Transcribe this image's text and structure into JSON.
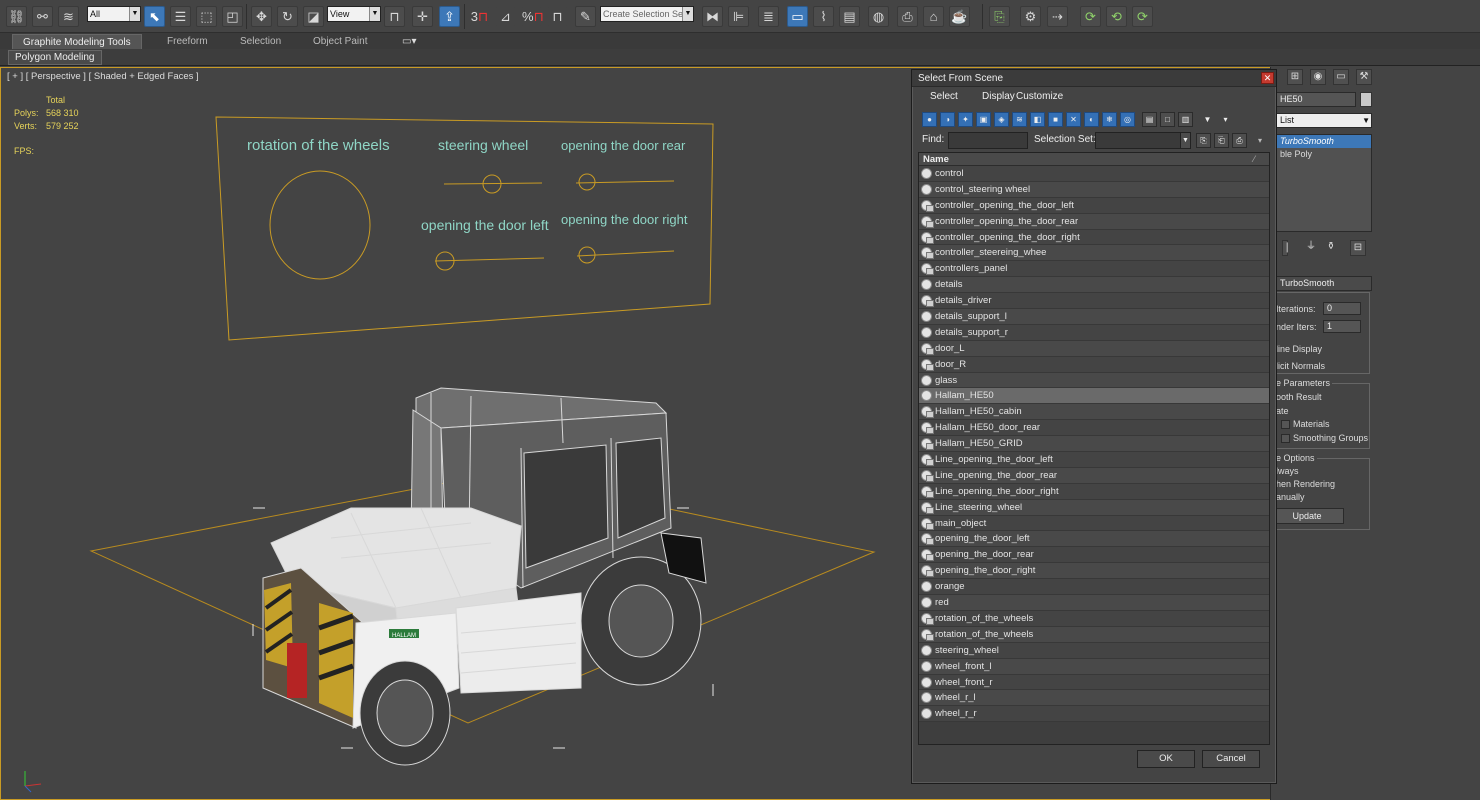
{
  "toolbar": {
    "selection_filter": "All",
    "ref_coord": "View",
    "named_selection_placeholder": "Create Selection Se",
    "snap_labels": [
      "3",
      "%"
    ]
  },
  "ribbon": {
    "tabs": [
      "Graphite Modeling Tools",
      "Freeform",
      "Selection",
      "Object Paint"
    ],
    "active_tab": 0,
    "panel_label": "Polygon Modeling"
  },
  "viewport": {
    "label": "[ + ] [ Perspective ] [ Shaded + Edged Faces ]",
    "stats": {
      "total_label": "Total",
      "polys_label": "Polys:",
      "polys_value": "568 310",
      "verts_label": "Verts:",
      "verts_value": "579 252",
      "fps_label": "FPS:"
    },
    "panel_texts": {
      "rotation": "rotation of the wheels",
      "steering": "steering wheel",
      "door_rear": "opening the door rear",
      "door_left": "opening the door left",
      "door_right": "opening the door right"
    },
    "brand_text": "HALLAM",
    "accent_yellow": "#c99b24",
    "label_color": "#8fd6c6"
  },
  "command_panel": {
    "object_name": "HE50",
    "modifier_dropdown": "List",
    "stack": [
      "TurboSmooth",
      "Editable Poly"
    ],
    "stack_visible": [
      "TurboSmooth",
      "ble Poly"
    ],
    "rollout_title": "TurboSmooth",
    "iterations_label": "Iterations:",
    "iterations_value": "0",
    "render_iters_label": "nder Iters:",
    "render_iters_value": "1",
    "isoline": "line Display",
    "explicit_normals": "licit Normals",
    "surface_params": "e Parameters",
    "smooth_result": "ooth Result",
    "separate": "ate",
    "materials": "Materials",
    "smoothing_groups": "Smoothing Groups",
    "update_options": "e Options",
    "always": "lways",
    "when_rendering": "hen Rendering",
    "manually": "anually",
    "update_button": "Update"
  },
  "dialog": {
    "title": "Select From Scene",
    "menu": [
      "Select",
      "Display",
      "Customize"
    ],
    "find_label": "Find:",
    "find_value": "",
    "selection_set_label": "Selection Set:",
    "selection_set_value": "",
    "column_header": "Name",
    "items": [
      {
        "name": "control",
        "grouped": false
      },
      {
        "name": "control_steering wheel",
        "grouped": false
      },
      {
        "name": "controller_opening_the_door_left",
        "grouped": true
      },
      {
        "name": "controller_opening_the_door_rear",
        "grouped": true
      },
      {
        "name": "controller_opening_the_door_right",
        "grouped": true
      },
      {
        "name": "controller_steereing_whee",
        "grouped": true
      },
      {
        "name": "controllers_panel",
        "grouped": true
      },
      {
        "name": "details",
        "grouped": false
      },
      {
        "name": "details_driver",
        "grouped": true
      },
      {
        "name": "details_support_l",
        "grouped": false
      },
      {
        "name": "details_support_r",
        "grouped": false
      },
      {
        "name": "door_L",
        "grouped": true
      },
      {
        "name": "door_R",
        "grouped": true
      },
      {
        "name": "glass",
        "grouped": false
      },
      {
        "name": "Hallam_HE50",
        "grouped": false
      },
      {
        "name": "Hallam_HE50_cabin",
        "grouped": true
      },
      {
        "name": "Hallam_HE50_door_rear",
        "grouped": true
      },
      {
        "name": "Hallam_HE50_GRID",
        "grouped": true
      },
      {
        "name": "Line_opening_the_door_left",
        "grouped": true
      },
      {
        "name": "Line_opening_the_door_rear",
        "grouped": true
      },
      {
        "name": "Line_opening_the_door_right",
        "grouped": true
      },
      {
        "name": "Line_steering_wheel",
        "grouped": true
      },
      {
        "name": "main_object",
        "grouped": true
      },
      {
        "name": "opening_the_door_left",
        "grouped": true
      },
      {
        "name": "opening_the_door_rear",
        "grouped": true
      },
      {
        "name": "opening_the_door_right",
        "grouped": true
      },
      {
        "name": "orange",
        "grouped": false
      },
      {
        "name": "red",
        "grouped": false
      },
      {
        "name": "rotation_of_the_wheels",
        "grouped": true
      },
      {
        "name": "rotation_of_the_wheels",
        "grouped": true
      },
      {
        "name": "steering_wheel",
        "grouped": false
      },
      {
        "name": "wheel_front_l",
        "grouped": false
      },
      {
        "name": "wheel_front_r",
        "grouped": false
      },
      {
        "name": "wheel_r_l",
        "grouped": false
      },
      {
        "name": "wheel_r_r",
        "grouped": false
      }
    ],
    "selected_index": 14,
    "ok_label": "OK",
    "cancel_label": "Cancel"
  }
}
